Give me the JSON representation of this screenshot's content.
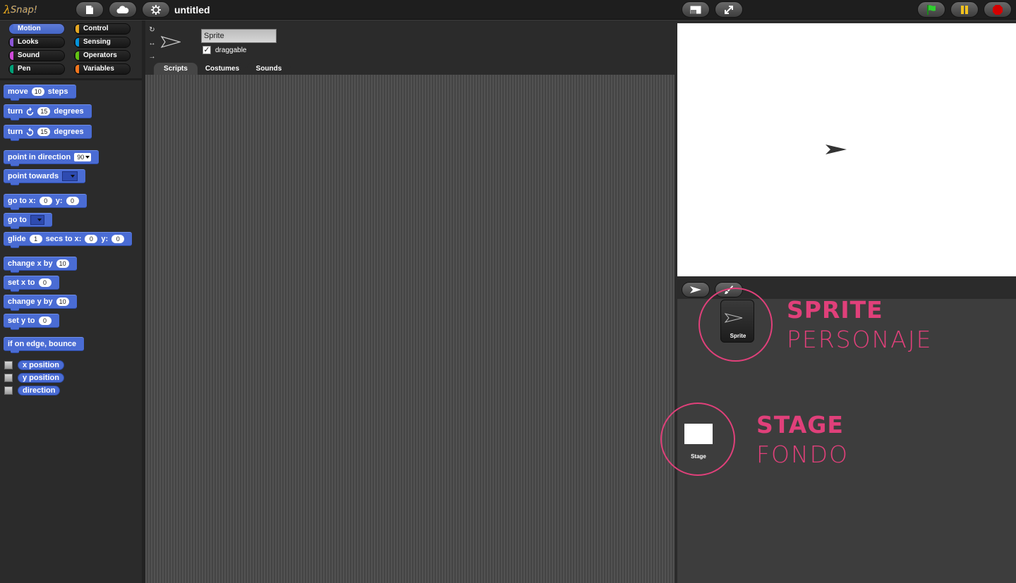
{
  "app": {
    "logo_text": "Snap!",
    "project_title": "untitled"
  },
  "toolbar": {
    "new_icon": "file-icon",
    "cloud_icon": "cloud-icon",
    "settings_icon": "gear-icon",
    "stage_size_icon": "stage-size-icon",
    "fullscreen_icon": "expand-icon",
    "green_flag_icon": "green-flag-icon",
    "pause_icon": "pause-icon",
    "stop_icon": "stop-icon"
  },
  "categories": [
    {
      "label": "Motion",
      "color": "#4a6cd4",
      "active": true
    },
    {
      "label": "Control",
      "color": "#e6a822"
    },
    {
      "label": "Looks",
      "color": "#8a55d7"
    },
    {
      "label": "Sensing",
      "color": "#0494dc"
    },
    {
      "label": "Sound",
      "color": "#cf4ad9"
    },
    {
      "label": "Operators",
      "color": "#62c213"
    },
    {
      "label": "Pen",
      "color": "#00a178"
    },
    {
      "label": "Variables",
      "color": "#f3761d"
    }
  ],
  "blocks": {
    "move": {
      "pre": "move",
      "val": "10",
      "post": "steps"
    },
    "turn_cw": {
      "pre": "turn",
      "val": "15",
      "post": "degrees"
    },
    "turn_ccw": {
      "pre": "turn",
      "val": "15",
      "post": "degrees"
    },
    "point_dir": {
      "pre": "point in direction",
      "val": "90"
    },
    "point_towards": {
      "pre": "point towards"
    },
    "goto_xy": {
      "pre": "go to x:",
      "x": "0",
      "mid": "y:",
      "y": "0"
    },
    "goto": {
      "pre": "go to"
    },
    "glide": {
      "pre": "glide",
      "secs": "1",
      "mid1": "secs to x:",
      "x": "0",
      "mid2": "y:",
      "y": "0"
    },
    "change_x": {
      "pre": "change x by",
      "val": "10"
    },
    "set_x": {
      "pre": "set x to",
      "val": "0"
    },
    "change_y": {
      "pre": "change y by",
      "val": "10"
    },
    "set_y": {
      "pre": "set y to",
      "val": "0"
    },
    "bounce": {
      "label": "if on edge, bounce"
    },
    "reporters": [
      "x position",
      "y position",
      "direction"
    ]
  },
  "sprite": {
    "name": "Sprite",
    "draggable_label": "draggable",
    "draggable": true
  },
  "tabs": [
    {
      "label": "Scripts",
      "active": true
    },
    {
      "label": "Costumes"
    },
    {
      "label": "Sounds"
    }
  ],
  "corral": {
    "sprite_label": "Sprite",
    "stage_label": "Stage",
    "add_sprite_icon": "turtle-arrow-icon",
    "paint_icon": "paintbrush-icon"
  },
  "annotations": {
    "sprite_title": "SPRITE",
    "sprite_sub": "PERSONAJE",
    "stage_title": "STAGE",
    "stage_sub": "FONDO",
    "color": "#e0407a"
  }
}
